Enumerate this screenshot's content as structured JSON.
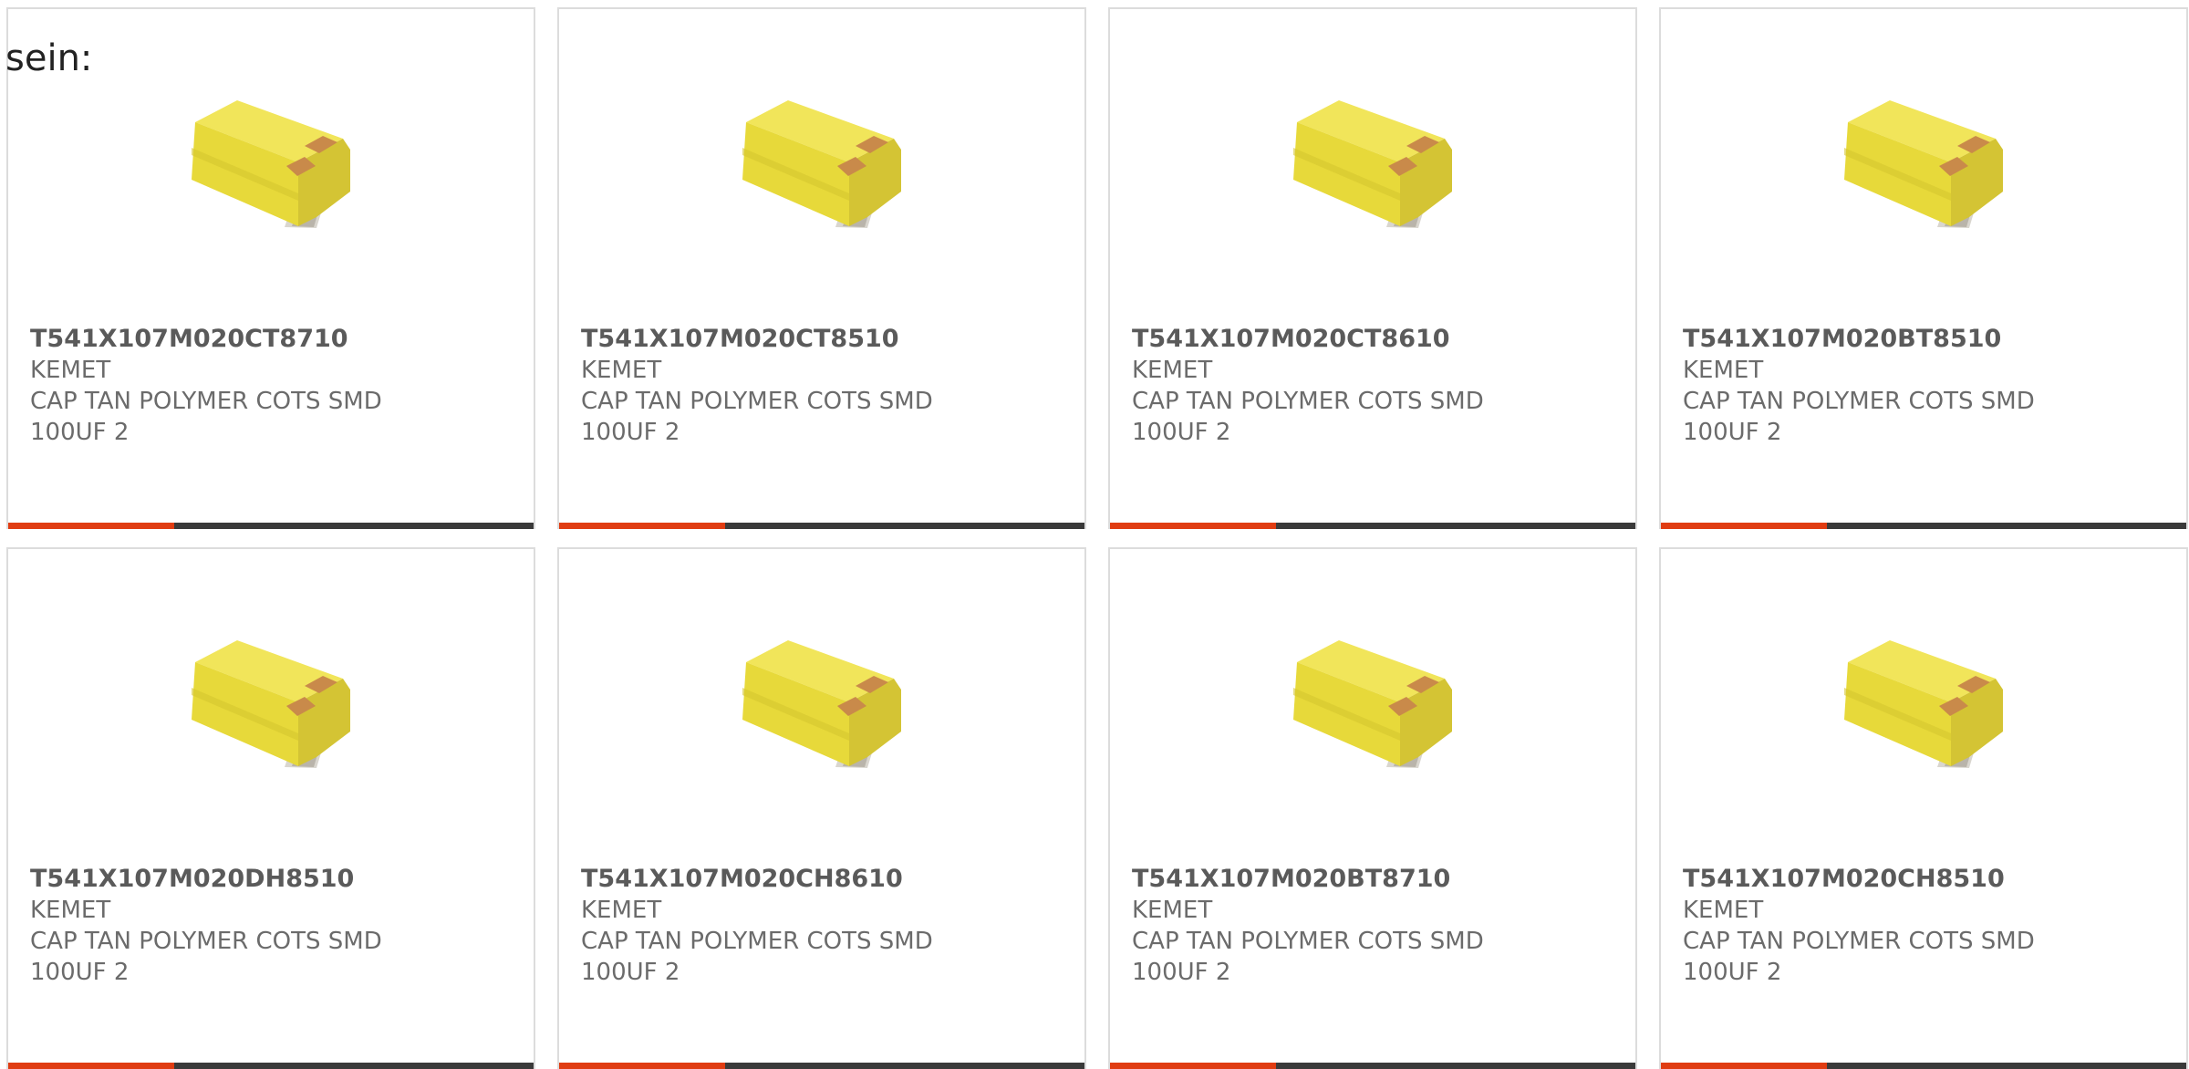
{
  "heading": "sein:",
  "colors": {
    "accent": "#e03c12",
    "bar": "#3a3a3a",
    "title_text": "#5a5a5a",
    "body_text": "#6b6b6b",
    "capacitor_body": "#ecdf3c",
    "terminal": "#c98a4a"
  },
  "products": [
    {
      "part_number": "T541X107M020CT8710",
      "manufacturer": "KEMET",
      "desc_line1": "CAP TAN POLYMER COTS SMD",
      "desc_line2": "100UF 2",
      "icon": "capacitor-smd-icon"
    },
    {
      "part_number": "T541X107M020CT8510",
      "manufacturer": "KEMET",
      "desc_line1": "CAP TAN POLYMER COTS SMD",
      "desc_line2": "100UF 2",
      "icon": "capacitor-smd-icon"
    },
    {
      "part_number": "T541X107M020CT8610",
      "manufacturer": "KEMET",
      "desc_line1": "CAP TAN POLYMER COTS SMD",
      "desc_line2": "100UF 2",
      "icon": "capacitor-smd-icon"
    },
    {
      "part_number": "T541X107M020BT8510",
      "manufacturer": "KEMET",
      "desc_line1": "CAP TAN POLYMER COTS SMD",
      "desc_line2": "100UF 2",
      "icon": "capacitor-smd-icon"
    },
    {
      "part_number": "T541X107M020DH8510",
      "manufacturer": "KEMET",
      "desc_line1": "CAP TAN POLYMER COTS SMD",
      "desc_line2": "100UF 2",
      "icon": "capacitor-smd-icon"
    },
    {
      "part_number": "T541X107M020CH8610",
      "manufacturer": "KEMET",
      "desc_line1": "CAP TAN POLYMER COTS SMD",
      "desc_line2": "100UF 2",
      "icon": "capacitor-smd-icon"
    },
    {
      "part_number": "T541X107M020BT8710",
      "manufacturer": "KEMET",
      "desc_line1": "CAP TAN POLYMER COTS SMD",
      "desc_line2": "100UF 2",
      "icon": "capacitor-smd-icon"
    },
    {
      "part_number": "T541X107M020CH8510",
      "manufacturer": "KEMET",
      "desc_line1": "CAP TAN POLYMER COTS SMD",
      "desc_line2": "100UF 2",
      "icon": "capacitor-smd-icon"
    }
  ]
}
